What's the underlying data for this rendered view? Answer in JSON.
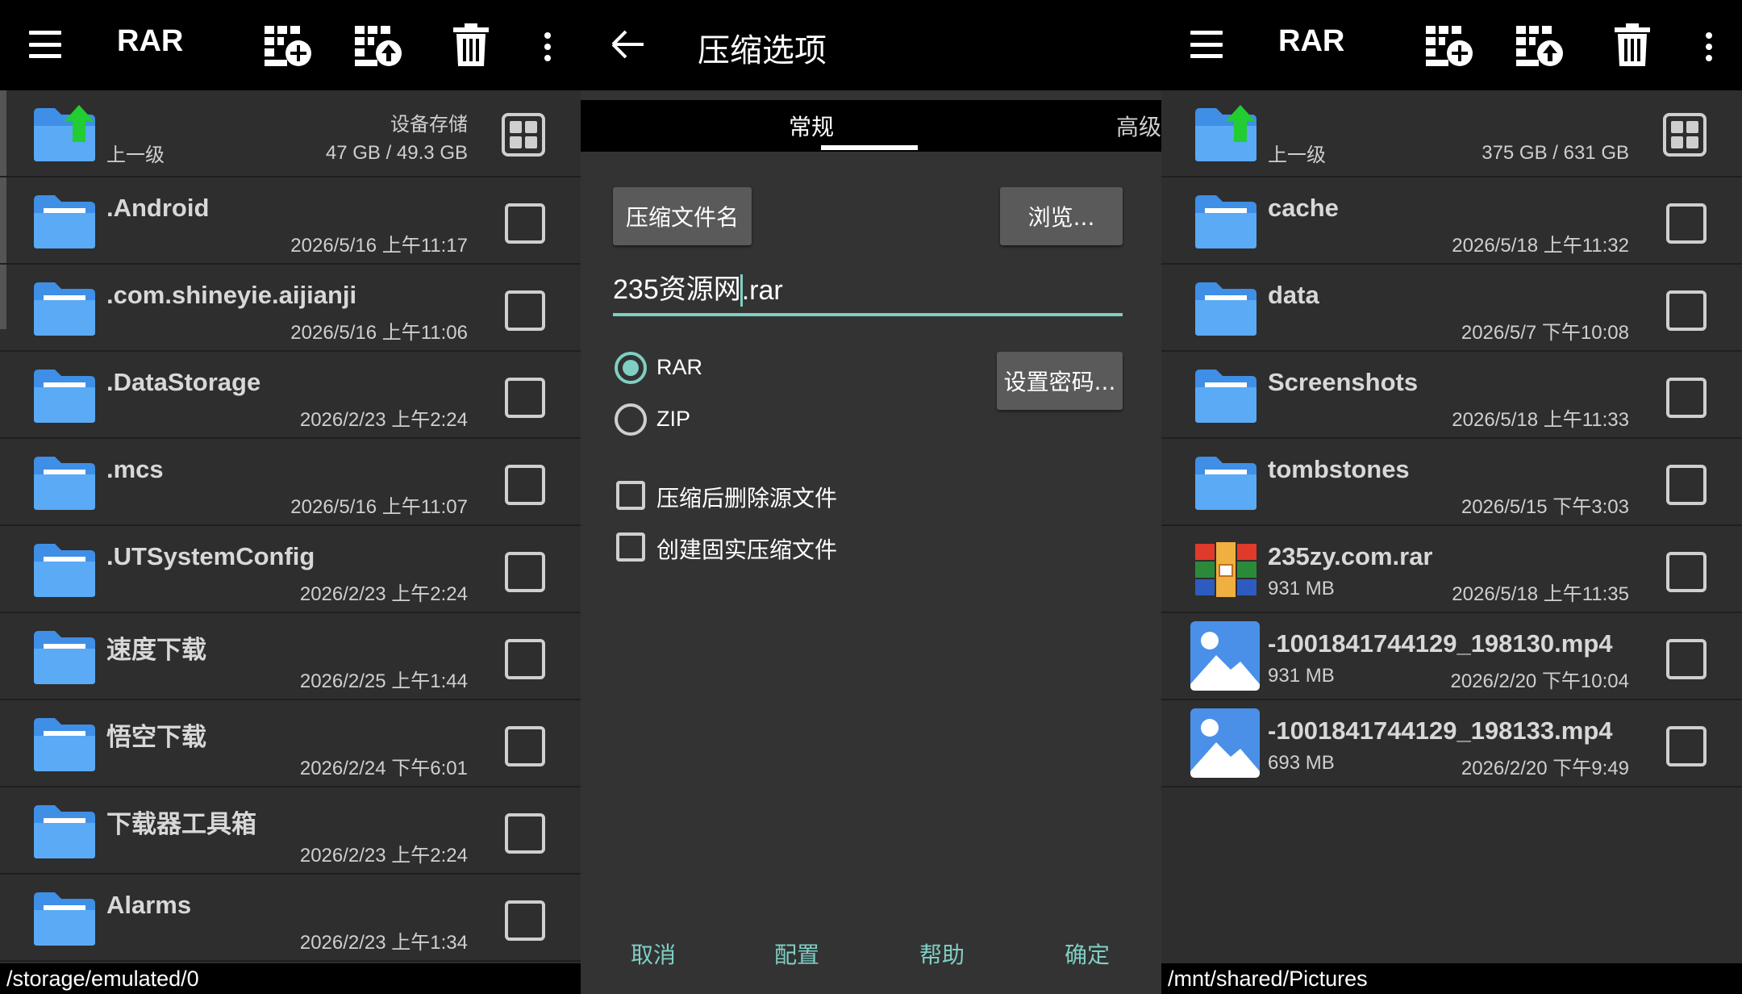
{
  "left": {
    "toolbar": {
      "title": "RAR"
    },
    "parent_row": {
      "label": "上一级",
      "storage_name": "设备存储",
      "storage_size": "47 GB / 49.3 GB"
    },
    "items": [
      {
        "name": ".Android",
        "date": "2026/5/16 上午11:17"
      },
      {
        "name": ".com.shineyie.aijianji",
        "date": "2026/5/16 上午11:06"
      },
      {
        "name": ".DataStorage",
        "date": "2026/2/23 上午2:24"
      },
      {
        "name": ".mcs",
        "date": "2026/5/16 上午11:07"
      },
      {
        "name": ".UTSystemConfig",
        "date": "2026/2/23 上午2:24"
      },
      {
        "name": "速度下载",
        "date": "2026/2/25 上午1:44"
      },
      {
        "name": "悟空下载",
        "date": "2026/2/24 下午6:01"
      },
      {
        "name": "下载器工具箱",
        "date": "2026/2/23 上午2:24"
      },
      {
        "name": "Alarms",
        "date": "2026/2/23 上午1:34"
      }
    ],
    "path": "/storage/emulated/0"
  },
  "middle": {
    "title": "压缩选项",
    "tabs": {
      "general": "常规",
      "advanced": "高级"
    },
    "archive_name_button": "压缩文件名",
    "browse_button": "浏览...",
    "filename_before_caret": "235资源网",
    "filename_after_caret": ".rar",
    "format_rar": "RAR",
    "format_zip": "ZIP",
    "set_password_button": "设置密码...",
    "option_delete": "压缩后删除源文件",
    "option_solid": "创建固实压缩文件",
    "actions": {
      "cancel": "取消",
      "profiles": "配置",
      "help": "帮助",
      "ok": "确定"
    }
  },
  "right": {
    "toolbar": {
      "title": "RAR"
    },
    "parent_row": {
      "label": "上一级",
      "storage_size": "375 GB / 631 GB"
    },
    "items": [
      {
        "name": "cache",
        "date": "2026/5/18 上午11:32"
      },
      {
        "name": "data",
        "date": "2026/5/7 下午10:08"
      },
      {
        "name": "Screenshots",
        "date": "2026/5/18 上午11:33"
      },
      {
        "name": "tombstones",
        "date": "2026/5/15 下午3:03"
      },
      {
        "name": "235zy.com.rar",
        "size": "931 MB",
        "date": "2026/5/18 上午11:35"
      },
      {
        "name": "-1001841744129_198130.mp4",
        "size": "931 MB",
        "date": "2026/2/20 下午10:04"
      },
      {
        "name": "-1001841744129_198133.mp4",
        "size": "693 MB",
        "date": "2026/2/20 下午9:49"
      }
    ],
    "path": "/mnt/shared/Pictures"
  },
  "colors": {
    "accent": "#7fcfc4",
    "folder": "#5aaaf5",
    "toolbar": "#000000",
    "background": "#2e2e2e"
  }
}
